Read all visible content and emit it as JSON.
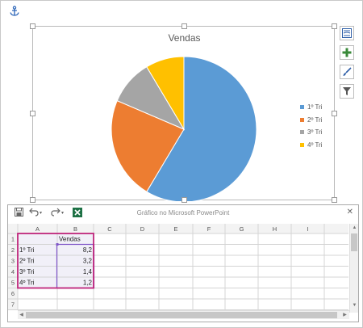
{
  "chart_data": {
    "type": "pie",
    "title": "Vendas",
    "categories": [
      "1º Tri",
      "2º Tri",
      "3º Tri",
      "4º Tri"
    ],
    "values": [
      8.2,
      3.2,
      1.4,
      1.2
    ],
    "colors": [
      "#5b9bd5",
      "#ed7d31",
      "#a5a5a5",
      "#ffc000"
    ],
    "legend_position": "right"
  },
  "spreadsheet": {
    "window_title": "Gráfico no Microsoft PowerPoint",
    "column_headers": [
      "A",
      "B",
      "C",
      "D",
      "E",
      "F",
      "G",
      "H",
      "I"
    ],
    "row_headers": [
      "1",
      "2",
      "3",
      "4",
      "5",
      "6",
      "7"
    ],
    "rows": [
      [
        "",
        "Vendas"
      ],
      [
        "1º Tri",
        "8,2"
      ],
      [
        "2º Tri",
        "3,2"
      ],
      [
        "3º Tri",
        "1,4"
      ],
      [
        "4º Tri",
        "1,2"
      ],
      [
        "",
        ""
      ],
      [
        "",
        ""
      ]
    ],
    "range_border_color": "#c0267b",
    "value_border_color": "#7f56c8"
  },
  "icons": {
    "anchor": "anchor-icon",
    "chart_elements": "plus-icon",
    "chart_styles": "paintbrush-icon",
    "chart_filters": "funnel-icon",
    "layout_options": "layout-options-icon",
    "save": "save-icon",
    "undo": "undo-icon",
    "redo": "redo-icon",
    "excel": "excel-icon",
    "close": "close-icon"
  }
}
